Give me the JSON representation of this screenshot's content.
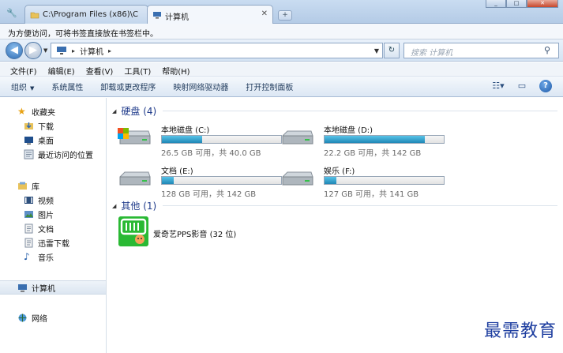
{
  "browser": {
    "tabs": [
      {
        "label": "C:\\Program Files (x86)\\C"
      },
      {
        "label": "计算机"
      }
    ],
    "bookmark_hint": "为方便访问，可将书签直接放在书签栏中。"
  },
  "address": {
    "root_label": "计算机",
    "search_placeholder": "搜索 计算机"
  },
  "menu": [
    "文件(F)",
    "编辑(E)",
    "查看(V)",
    "工具(T)",
    "帮助(H)"
  ],
  "toolbar": {
    "organize": "组织",
    "items": [
      "系统属性",
      "卸载或更改程序",
      "映射网络驱动器",
      "打开控制面板"
    ]
  },
  "sidebar": {
    "favorites_header": "收藏夹",
    "favorites": [
      "下载",
      "桌面",
      "最近访问的位置"
    ],
    "libraries_header": "库",
    "libraries": [
      "视频",
      "图片",
      "文档",
      "迅雷下载",
      "音乐"
    ],
    "computer": "计算机",
    "network": "网络"
  },
  "main": {
    "hard_disk_group": "硬盘 (4)",
    "drives": [
      {
        "name": "本地磁盘 (C:)",
        "free": "26.5 GB 可用，共 40.0 GB",
        "used_fraction": 0.34
      },
      {
        "name": "本地磁盘 (D:)",
        "free": "22.2 GB 可用，共 142 GB",
        "used_fraction": 0.84
      },
      {
        "name": "文档 (E:)",
        "free": "128 GB 可用，共 142 GB",
        "used_fraction": 0.1
      },
      {
        "name": "娱乐 (F:)",
        "free": "127 GB 可用，共 141 GB",
        "used_fraction": 0.1
      }
    ],
    "other_group": "其他 (1)",
    "app_label": "爱奇艺PPS影音 (32 位)"
  },
  "watermark": "最需教育"
}
